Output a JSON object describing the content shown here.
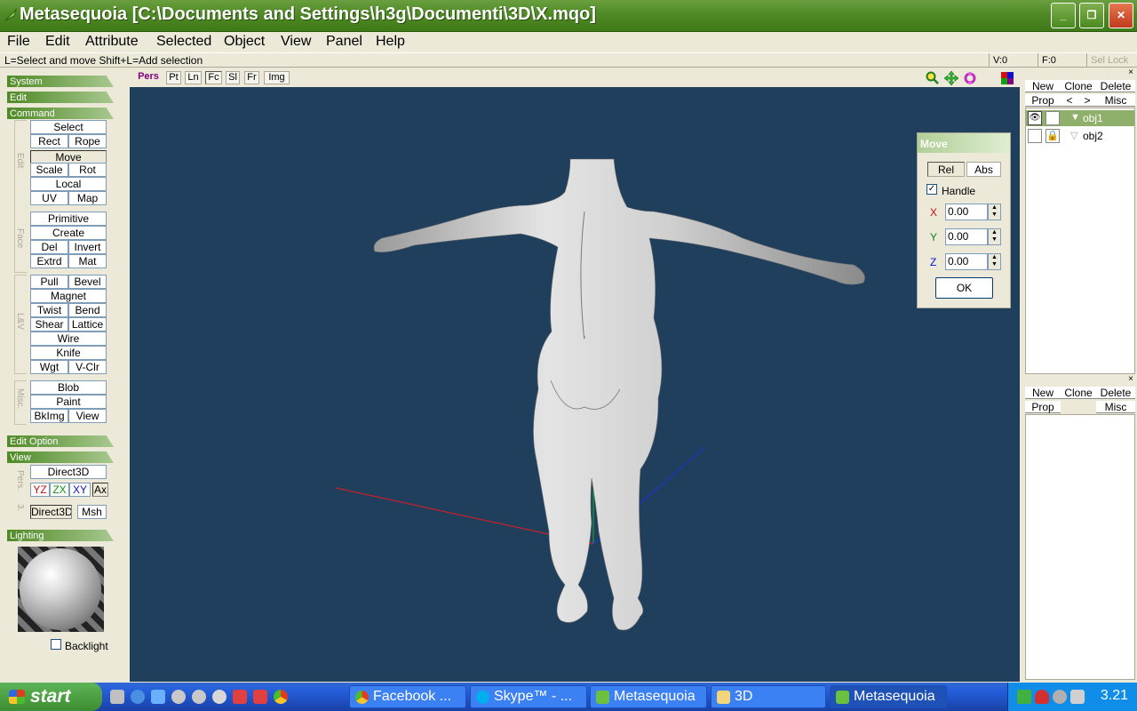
{
  "window": {
    "title": "Metasequoia [C:\\Documents and Settings\\h3g\\Documenti\\3D\\X.mqo]"
  },
  "menu": [
    "File",
    "Edit",
    "Attribute",
    "Selected",
    "Object",
    "View",
    "Panel",
    "Help"
  ],
  "hint": "L=Select and move  Shift+L=Add selection",
  "status": {
    "vertices": "V:0",
    "faces": "F:0",
    "sel_lock": "Sel Lock"
  },
  "left": {
    "sections": [
      "System",
      "Edit",
      "Command",
      "Edit Option",
      "View",
      "Lighting"
    ],
    "group_labels": [
      "Edit",
      "Face",
      "L&V",
      "Misc.",
      "Pers.",
      "3."
    ],
    "tools": [
      "Select",
      "Rect",
      "Rope",
      "Move",
      "Scale",
      "Rot",
      "Local",
      "UV",
      "Map",
      "Primitive",
      "Create",
      "Del",
      "Invert",
      "Extrd",
      "Mat",
      "Pull",
      "Bevel",
      "Magnet",
      "Twist",
      "Bend",
      "Shear",
      "Lattice",
      "Wire",
      "Knife",
      "Wgt",
      "V-Clr",
      "Blob",
      "Paint",
      "BkImg",
      "View"
    ],
    "view_buttons": [
      "Direct3D",
      "YZ",
      "ZX",
      "XY",
      "Ax",
      "Direct3D",
      "Msh"
    ],
    "backlight": "Backlight"
  },
  "viewtabs": [
    "Pers",
    "Pt",
    "Ln",
    "Fc",
    "Sl",
    "Fr",
    "Img"
  ],
  "move": {
    "title": "Move",
    "rel": "Rel",
    "abs": "Abs",
    "handle": "Handle",
    "x_label": "X",
    "y_label": "Y",
    "z_label": "Z",
    "x": "0.00",
    "y": "0.00",
    "z": "0.00",
    "ok": "OK"
  },
  "right": {
    "buttons": [
      "New",
      "Clone",
      "Delete",
      "Prop",
      "<",
      ">",
      "Misc"
    ],
    "objects": [
      "obj1",
      "obj2"
    ],
    "buttons2": [
      "New",
      "Clone",
      "Delete",
      "Prop",
      "Misc"
    ]
  },
  "taskbar": {
    "start": "start",
    "tasks": [
      "Facebook ...",
      "Skype™ - ...",
      "Metasequoia",
      "3D",
      "Metasequoia"
    ],
    "clock": "3.21"
  },
  "colors": {
    "viewport": "#1f3f5d",
    "titlebar": "#4f8a26",
    "axis_x": "#c8202a",
    "axis_y": "#1fa02a",
    "axis_z": "#1a36c8"
  }
}
